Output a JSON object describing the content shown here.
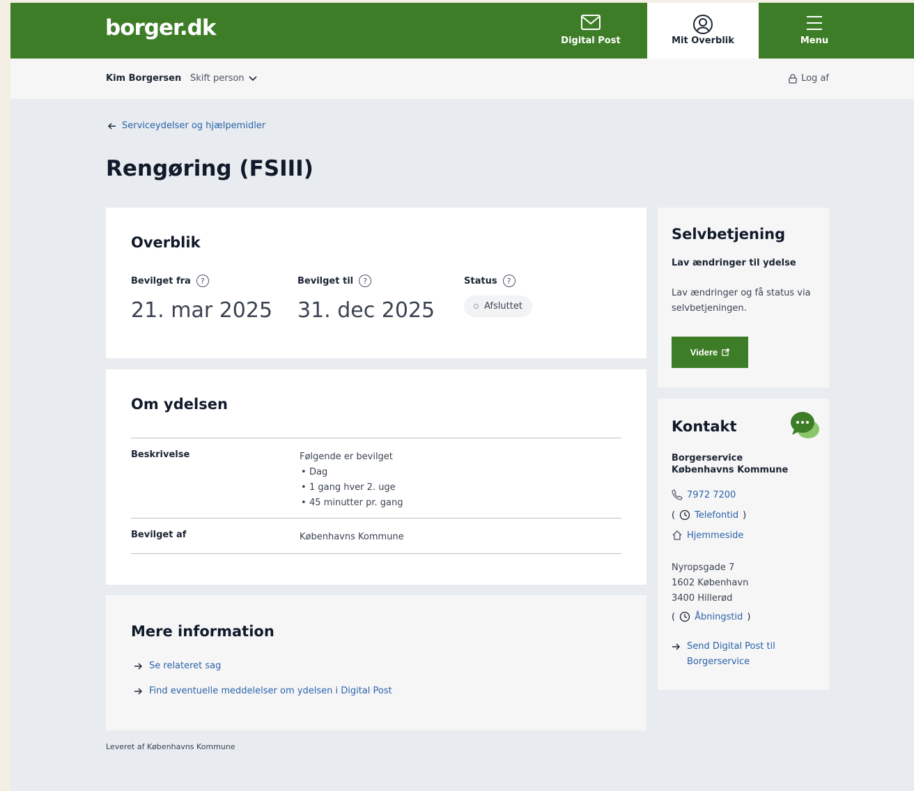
{
  "header": {
    "logo": "borger.dk",
    "nav": [
      {
        "label": "Digital Post",
        "icon": "envelope-icon"
      },
      {
        "label": "Mit Overblik",
        "icon": "user-circle-icon",
        "active": true
      },
      {
        "label": "Menu",
        "icon": "hamburger-icon"
      }
    ],
    "accent_color": "#3e7d27"
  },
  "subheader": {
    "user_name": "Kim Borgersen",
    "switch_person": "Skift person",
    "logout": "Log af"
  },
  "breadcrumb": {
    "back_label": "Serviceydelser og hjælpemidler"
  },
  "page_title": "Rengøring (FSIII)",
  "overblik": {
    "title": "Overblik",
    "granted_from_label": "Bevilget fra",
    "granted_from_value": "21. mar 2025",
    "granted_to_label": "Bevilget til",
    "granted_to_value": "31. dec 2025",
    "status_label": "Status",
    "status_value": "Afsluttet"
  },
  "om_ydelsen": {
    "title": "Om ydelsen",
    "description_label": "Beskrivelse",
    "description_intro": "Følgende er bevilget",
    "description_items": [
      "Dag",
      "1 gang hver 2. uge",
      "45 minutter pr. gang"
    ],
    "granted_by_label": "Bevilget af",
    "granted_by_value": "Københavns Kommune"
  },
  "mere_information": {
    "title": "Mere information",
    "links": [
      "Se relateret sag",
      "Find eventuelle meddelelser om ydelsen i Digital Post"
    ]
  },
  "footer_note": "Leveret af Københavns Kommune",
  "selvbetjening": {
    "title": "Selvbetjening",
    "subtitle": "Lav ændringer til ydelse",
    "description": "Lav ændringer og få status via selvbetjeningen.",
    "button_label": "Videre"
  },
  "kontakt": {
    "title": "Kontakt",
    "org_line1": "Borgerservice",
    "org_line2": "Københavns Kommune",
    "phone": "7972 7200",
    "phone_hours": "Telefontid",
    "website": "Hjemmeside",
    "address_lines": [
      "Nyropsgade 7",
      "1602 København",
      "3400 Hillerød"
    ],
    "opening_hours": "Åbningstid",
    "send_post": "Send Digital Post til Borgerservice"
  }
}
